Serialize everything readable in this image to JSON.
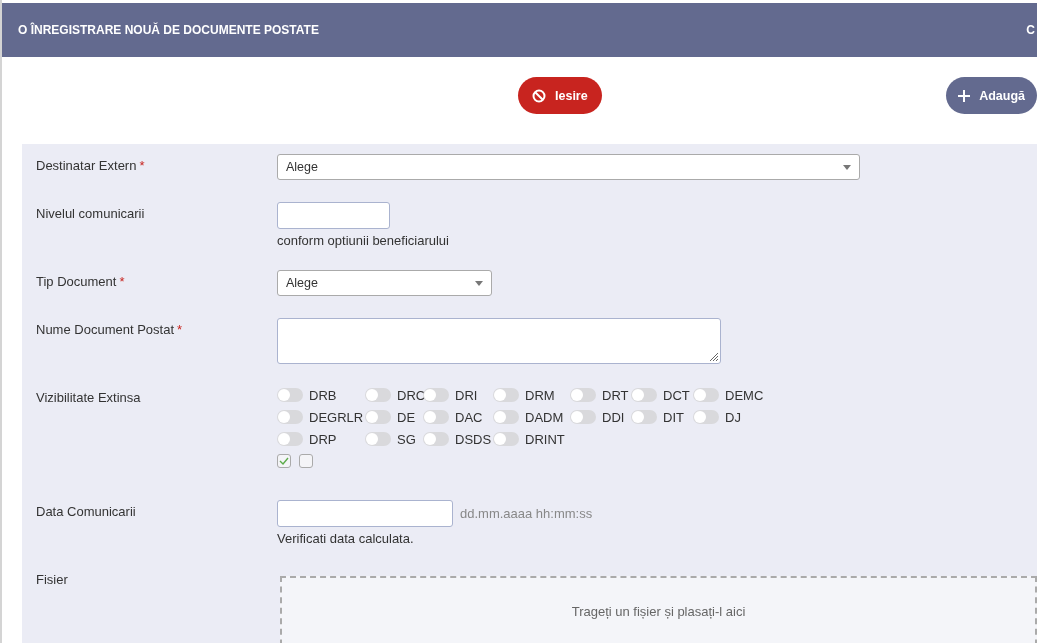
{
  "header": {
    "title": "O ÎNREGISTRARE NOUĂ DE DOCUMENTE POSTATE",
    "right_text": "C"
  },
  "actions": [
    {
      "label": "Iesire",
      "kind": "exit"
    },
    {
      "label": "Adaugă",
      "kind": "add"
    }
  ],
  "fields": [
    {
      "kind": "select_wide",
      "label": "Destinatar Extern",
      "required_mark": "*",
      "value": "Alege"
    },
    {
      "kind": "text",
      "label": "Nivelul comunicarii",
      "help": "conform optiunii beneficiarului"
    },
    {
      "kind": "select",
      "label": "Tip Document",
      "required_mark": "*",
      "value": "Alege"
    },
    {
      "kind": "textarea",
      "label": "Nume Document Postat",
      "required_mark": "*"
    },
    {
      "kind": "toggles",
      "label": "Vizibilitate Extinsa",
      "toggles": [
        {
          "label": "DRB",
          "on": false
        },
        {
          "label": "DRC",
          "on": false
        },
        {
          "label": "DRI",
          "on": false
        },
        {
          "label": "DRM",
          "on": false
        },
        {
          "label": "DRT",
          "on": false
        },
        {
          "label": "DCT",
          "on": false
        },
        {
          "label": "DEMC",
          "on": false
        },
        {
          "label": "DEGRLR",
          "on": false
        },
        {
          "label": "DE",
          "on": false
        },
        {
          "label": "DAC",
          "on": false
        },
        {
          "label": "DADM",
          "on": false
        },
        {
          "label": "DDI",
          "on": false
        },
        {
          "label": "DIT",
          "on": false
        },
        {
          "label": "DJ",
          "on": false
        },
        {
          "label": "DRP",
          "on": false
        },
        {
          "label": "SG",
          "on": false
        },
        {
          "label": "DSDS",
          "on": false
        },
        {
          "label": "DRINT",
          "on": false
        }
      ],
      "checkboxes": [
        {
          "checked": true
        },
        {
          "checked": false
        }
      ]
    },
    {
      "kind": "date",
      "label": "Data Comunicarii",
      "format": "dd.mm.aaaa hh:mm:ss",
      "help": "Verificati data calculata."
    },
    {
      "kind": "file",
      "label": "Fisier",
      "drop_text": "Trageți un fișier și plasați-l aici"
    }
  ]
}
